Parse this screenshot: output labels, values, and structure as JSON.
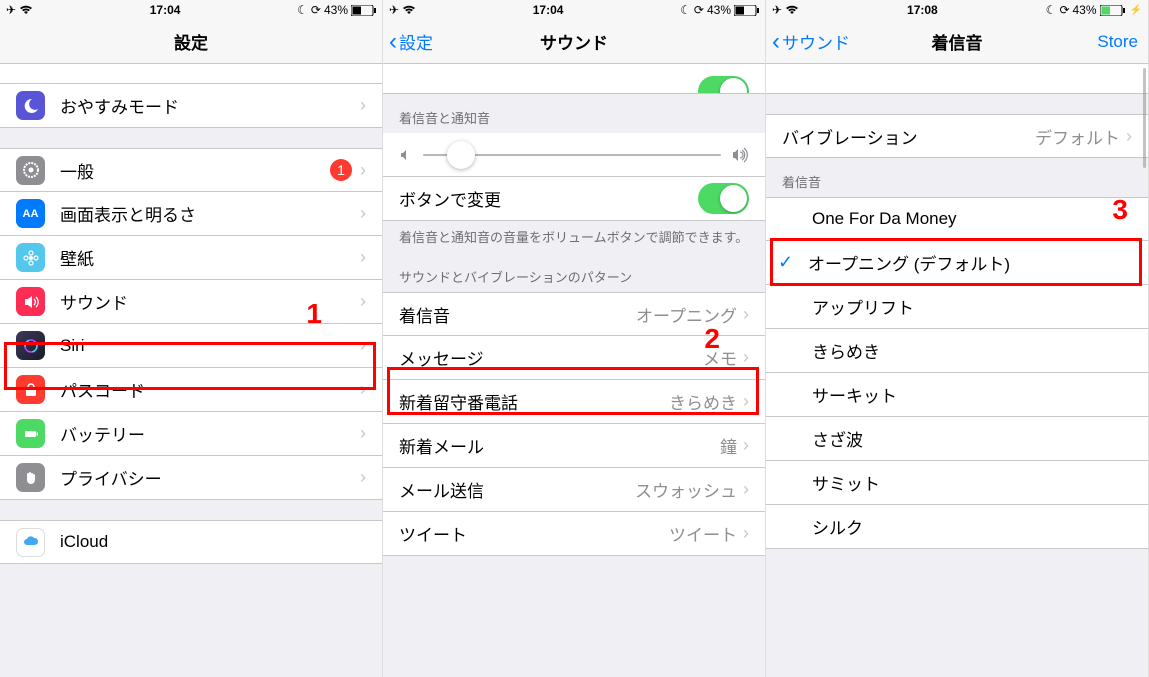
{
  "screen1": {
    "status": {
      "time": "17:04",
      "battery": "43%"
    },
    "nav": {
      "title": "設定"
    },
    "rows": {
      "dnd": "おやすみモード",
      "general": "一般",
      "display": "画面表示と明るさ",
      "wallpaper": "壁紙",
      "sounds": "サウンド",
      "siri": "Siri",
      "passcode": "パスコード",
      "battery": "バッテリー",
      "privacy": "プライバシー",
      "icloud": "iCloud"
    },
    "badge_general": "1",
    "annotation": "1"
  },
  "screen2": {
    "status": {
      "time": "17:04",
      "battery": "43%"
    },
    "nav": {
      "back": "設定",
      "title": "サウンド"
    },
    "section1_header": "着信音と通知音",
    "row_button_change": "ボタンで変更",
    "footer1": "着信音と通知音の音量をボリュームボタンで調節できます。",
    "section2_header": "サウンドとバイブレーションのパターン",
    "rows": {
      "ringtone": {
        "label": "着信音",
        "value": "オープニング"
      },
      "message": {
        "label": "メッセージ",
        "value": "メモ"
      },
      "voicemail": {
        "label": "新着留守番電話",
        "value": "きらめき"
      },
      "newmail": {
        "label": "新着メール",
        "value": "鐘"
      },
      "sentmail": {
        "label": "メール送信",
        "value": "スウォッシュ"
      },
      "tweet": {
        "label": "ツイート",
        "value": "ツイート"
      }
    },
    "annotation": "2"
  },
  "screen3": {
    "status": {
      "time": "17:08",
      "battery": "43%"
    },
    "nav": {
      "back": "サウンド",
      "title": "着信音",
      "right": "Store"
    },
    "vibration": {
      "label": "バイブレーション",
      "value": "デフォルト"
    },
    "section_header": "着信音",
    "tones": {
      "custom": "One For Da Money",
      "default": "オープニング (デフォルト)",
      "uplift": "アップリフト",
      "kirameki": "きらめき",
      "circuit": "サーキット",
      "sazanami": "さざ波",
      "summit": "サミット",
      "silk": "シルク"
    },
    "annotation": "3"
  }
}
